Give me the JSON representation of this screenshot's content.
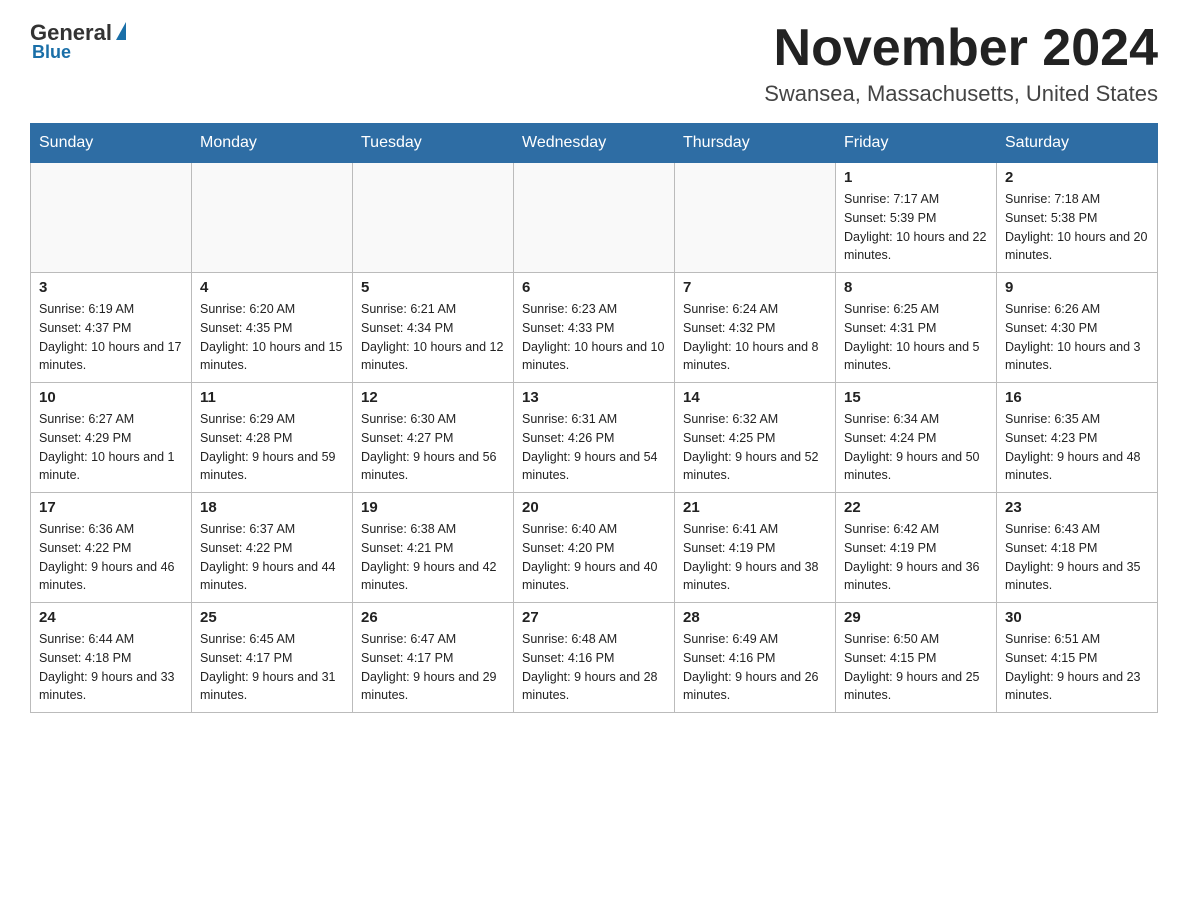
{
  "header": {
    "logo_general": "General",
    "logo_blue": "Blue",
    "month_title": "November 2024",
    "location": "Swansea, Massachusetts, United States"
  },
  "weekdays": [
    "Sunday",
    "Monday",
    "Tuesday",
    "Wednesday",
    "Thursday",
    "Friday",
    "Saturday"
  ],
  "weeks": [
    [
      {
        "day": "",
        "info": ""
      },
      {
        "day": "",
        "info": ""
      },
      {
        "day": "",
        "info": ""
      },
      {
        "day": "",
        "info": ""
      },
      {
        "day": "",
        "info": ""
      },
      {
        "day": "1",
        "info": "Sunrise: 7:17 AM\nSunset: 5:39 PM\nDaylight: 10 hours and 22 minutes."
      },
      {
        "day": "2",
        "info": "Sunrise: 7:18 AM\nSunset: 5:38 PM\nDaylight: 10 hours and 20 minutes."
      }
    ],
    [
      {
        "day": "3",
        "info": "Sunrise: 6:19 AM\nSunset: 4:37 PM\nDaylight: 10 hours and 17 minutes."
      },
      {
        "day": "4",
        "info": "Sunrise: 6:20 AM\nSunset: 4:35 PM\nDaylight: 10 hours and 15 minutes."
      },
      {
        "day": "5",
        "info": "Sunrise: 6:21 AM\nSunset: 4:34 PM\nDaylight: 10 hours and 12 minutes."
      },
      {
        "day": "6",
        "info": "Sunrise: 6:23 AM\nSunset: 4:33 PM\nDaylight: 10 hours and 10 minutes."
      },
      {
        "day": "7",
        "info": "Sunrise: 6:24 AM\nSunset: 4:32 PM\nDaylight: 10 hours and 8 minutes."
      },
      {
        "day": "8",
        "info": "Sunrise: 6:25 AM\nSunset: 4:31 PM\nDaylight: 10 hours and 5 minutes."
      },
      {
        "day": "9",
        "info": "Sunrise: 6:26 AM\nSunset: 4:30 PM\nDaylight: 10 hours and 3 minutes."
      }
    ],
    [
      {
        "day": "10",
        "info": "Sunrise: 6:27 AM\nSunset: 4:29 PM\nDaylight: 10 hours and 1 minute."
      },
      {
        "day": "11",
        "info": "Sunrise: 6:29 AM\nSunset: 4:28 PM\nDaylight: 9 hours and 59 minutes."
      },
      {
        "day": "12",
        "info": "Sunrise: 6:30 AM\nSunset: 4:27 PM\nDaylight: 9 hours and 56 minutes."
      },
      {
        "day": "13",
        "info": "Sunrise: 6:31 AM\nSunset: 4:26 PM\nDaylight: 9 hours and 54 minutes."
      },
      {
        "day": "14",
        "info": "Sunrise: 6:32 AM\nSunset: 4:25 PM\nDaylight: 9 hours and 52 minutes."
      },
      {
        "day": "15",
        "info": "Sunrise: 6:34 AM\nSunset: 4:24 PM\nDaylight: 9 hours and 50 minutes."
      },
      {
        "day": "16",
        "info": "Sunrise: 6:35 AM\nSunset: 4:23 PM\nDaylight: 9 hours and 48 minutes."
      }
    ],
    [
      {
        "day": "17",
        "info": "Sunrise: 6:36 AM\nSunset: 4:22 PM\nDaylight: 9 hours and 46 minutes."
      },
      {
        "day": "18",
        "info": "Sunrise: 6:37 AM\nSunset: 4:22 PM\nDaylight: 9 hours and 44 minutes."
      },
      {
        "day": "19",
        "info": "Sunrise: 6:38 AM\nSunset: 4:21 PM\nDaylight: 9 hours and 42 minutes."
      },
      {
        "day": "20",
        "info": "Sunrise: 6:40 AM\nSunset: 4:20 PM\nDaylight: 9 hours and 40 minutes."
      },
      {
        "day": "21",
        "info": "Sunrise: 6:41 AM\nSunset: 4:19 PM\nDaylight: 9 hours and 38 minutes."
      },
      {
        "day": "22",
        "info": "Sunrise: 6:42 AM\nSunset: 4:19 PM\nDaylight: 9 hours and 36 minutes."
      },
      {
        "day": "23",
        "info": "Sunrise: 6:43 AM\nSunset: 4:18 PM\nDaylight: 9 hours and 35 minutes."
      }
    ],
    [
      {
        "day": "24",
        "info": "Sunrise: 6:44 AM\nSunset: 4:18 PM\nDaylight: 9 hours and 33 minutes."
      },
      {
        "day": "25",
        "info": "Sunrise: 6:45 AM\nSunset: 4:17 PM\nDaylight: 9 hours and 31 minutes."
      },
      {
        "day": "26",
        "info": "Sunrise: 6:47 AM\nSunset: 4:17 PM\nDaylight: 9 hours and 29 minutes."
      },
      {
        "day": "27",
        "info": "Sunrise: 6:48 AM\nSunset: 4:16 PM\nDaylight: 9 hours and 28 minutes."
      },
      {
        "day": "28",
        "info": "Sunrise: 6:49 AM\nSunset: 4:16 PM\nDaylight: 9 hours and 26 minutes."
      },
      {
        "day": "29",
        "info": "Sunrise: 6:50 AM\nSunset: 4:15 PM\nDaylight: 9 hours and 25 minutes."
      },
      {
        "day": "30",
        "info": "Sunrise: 6:51 AM\nSunset: 4:15 PM\nDaylight: 9 hours and 23 minutes."
      }
    ]
  ]
}
